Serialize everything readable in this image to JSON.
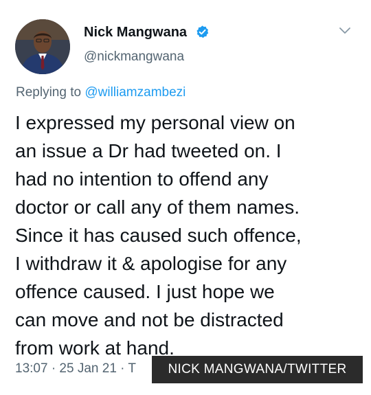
{
  "author": {
    "display_name": "Nick Mangwana",
    "handle": "@nickmangwana",
    "verified": true
  },
  "reply": {
    "prefix": "Replying to ",
    "mention": "@williamzambezi"
  },
  "tweet_lines": [
    "I expressed my personal view on",
    "an issue a Dr had tweeted on. I",
    "had no intention to offend any",
    "doctor or call any of them names.",
    "Since it has caused such offence,",
    "I withdraw it & apologise for any",
    "offence caused. I just hope we",
    "can move and not be distracted",
    "from work at hand."
  ],
  "meta": {
    "timestamp": "13:07 · 25 Jan 21 · T"
  },
  "caption": {
    "text": "NICK MANGWANA/TWITTER"
  },
  "colors": {
    "verified": "#1d9bf0",
    "mention": "#1d9bf0",
    "secondary_text": "#536471",
    "caption_bg": "#2b2b2b"
  },
  "icons": {
    "verified": "verified-badge-icon",
    "menu": "chevron-down-icon"
  }
}
